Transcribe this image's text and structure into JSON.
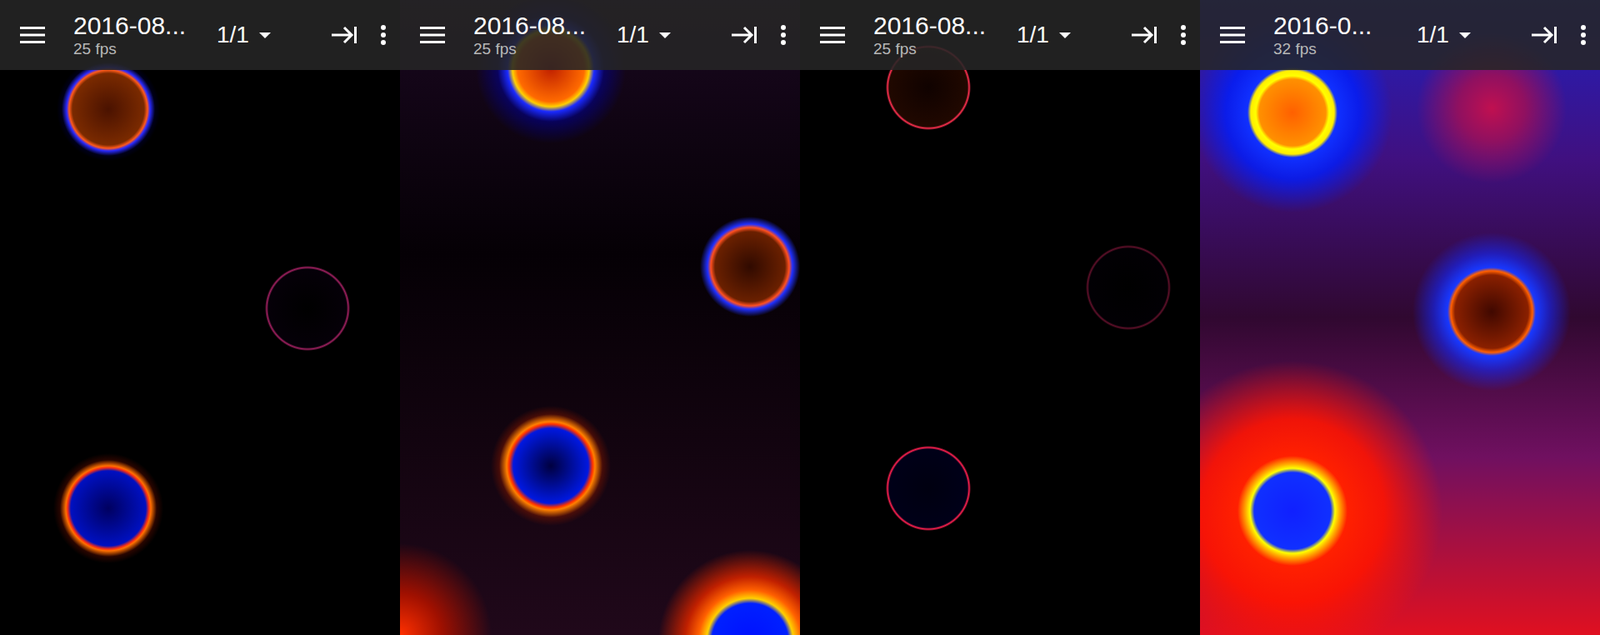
{
  "screens": [
    {
      "title": "2016-08...",
      "fps": "25 fps",
      "page": "1/1"
    },
    {
      "title": "2016-08...",
      "fps": "25 fps",
      "page": "1/1"
    },
    {
      "title": "2016-08...",
      "fps": "25 fps",
      "page": "1/1"
    },
    {
      "title": "2016-0...",
      "fps": "32 fps",
      "page": "1/1"
    }
  ]
}
